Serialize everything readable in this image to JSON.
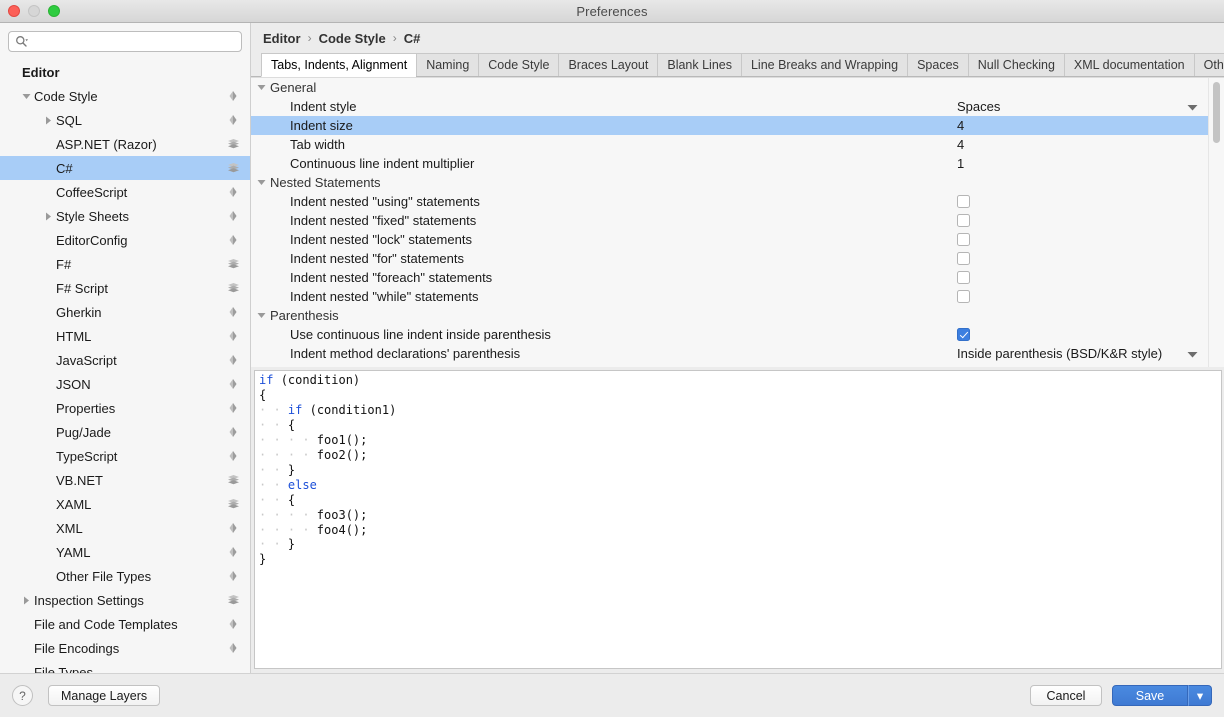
{
  "window": {
    "title": "Preferences",
    "traffic_lights": [
      "close",
      "minimize",
      "zoom"
    ]
  },
  "sidebar": {
    "search": {
      "value": "",
      "placeholder": ""
    },
    "items": [
      {
        "label": "Editor",
        "depth": 0,
        "twisty": "none",
        "icon": "none",
        "bold": true,
        "selected": false
      },
      {
        "label": "Code Style",
        "depth": 1,
        "twisty": "expanded",
        "icon": "diamond",
        "bold": false,
        "selected": false
      },
      {
        "label": "SQL",
        "depth": 2,
        "twisty": "collapsed",
        "icon": "diamond",
        "bold": false,
        "selected": false
      },
      {
        "label": "ASP.NET (Razor)",
        "depth": 2,
        "twisty": "none",
        "icon": "layers",
        "bold": false,
        "selected": false
      },
      {
        "label": "C#",
        "depth": 2,
        "twisty": "none",
        "icon": "layers",
        "bold": false,
        "selected": true
      },
      {
        "label": "CoffeeScript",
        "depth": 2,
        "twisty": "none",
        "icon": "diamond",
        "bold": false,
        "selected": false
      },
      {
        "label": "Style Sheets",
        "depth": 2,
        "twisty": "collapsed",
        "icon": "diamond",
        "bold": false,
        "selected": false
      },
      {
        "label": "EditorConfig",
        "depth": 2,
        "twisty": "none",
        "icon": "diamond",
        "bold": false,
        "selected": false
      },
      {
        "label": "F#",
        "depth": 2,
        "twisty": "none",
        "icon": "layers",
        "bold": false,
        "selected": false
      },
      {
        "label": "F# Script",
        "depth": 2,
        "twisty": "none",
        "icon": "layers",
        "bold": false,
        "selected": false
      },
      {
        "label": "Gherkin",
        "depth": 2,
        "twisty": "none",
        "icon": "diamond",
        "bold": false,
        "selected": false
      },
      {
        "label": "HTML",
        "depth": 2,
        "twisty": "none",
        "icon": "diamond",
        "bold": false,
        "selected": false
      },
      {
        "label": "JavaScript",
        "depth": 2,
        "twisty": "none",
        "icon": "diamond",
        "bold": false,
        "selected": false
      },
      {
        "label": "JSON",
        "depth": 2,
        "twisty": "none",
        "icon": "diamond",
        "bold": false,
        "selected": false
      },
      {
        "label": "Properties",
        "depth": 2,
        "twisty": "none",
        "icon": "diamond",
        "bold": false,
        "selected": false
      },
      {
        "label": "Pug/Jade",
        "depth": 2,
        "twisty": "none",
        "icon": "diamond",
        "bold": false,
        "selected": false
      },
      {
        "label": "TypeScript",
        "depth": 2,
        "twisty": "none",
        "icon": "diamond",
        "bold": false,
        "selected": false
      },
      {
        "label": "VB.NET",
        "depth": 2,
        "twisty": "none",
        "icon": "layers",
        "bold": false,
        "selected": false
      },
      {
        "label": "XAML",
        "depth": 2,
        "twisty": "none",
        "icon": "layers",
        "bold": false,
        "selected": false
      },
      {
        "label": "XML",
        "depth": 2,
        "twisty": "none",
        "icon": "diamond",
        "bold": false,
        "selected": false
      },
      {
        "label": "YAML",
        "depth": 2,
        "twisty": "none",
        "icon": "diamond",
        "bold": false,
        "selected": false
      },
      {
        "label": "Other File Types",
        "depth": 2,
        "twisty": "none",
        "icon": "diamond",
        "bold": false,
        "selected": false
      },
      {
        "label": "Inspection Settings",
        "depth": 1,
        "twisty": "collapsed",
        "icon": "layers",
        "bold": false,
        "selected": false
      },
      {
        "label": "File and Code Templates",
        "depth": 1,
        "twisty": "none",
        "icon": "diamond",
        "bold": false,
        "selected": false
      },
      {
        "label": "File Encodings",
        "depth": 1,
        "twisty": "none",
        "icon": "diamond",
        "bold": false,
        "selected": false
      },
      {
        "label": "File Types",
        "depth": 1,
        "twisty": "none",
        "icon": "none",
        "bold": false,
        "selected": false
      }
    ]
  },
  "breadcrumb": [
    "Editor",
    "Code Style",
    "C#"
  ],
  "tabs": [
    {
      "label": "Tabs, Indents, Alignment",
      "active": true
    },
    {
      "label": "Naming",
      "active": false
    },
    {
      "label": "Code Style",
      "active": false
    },
    {
      "label": "Braces Layout",
      "active": false
    },
    {
      "label": "Blank Lines",
      "active": false
    },
    {
      "label": "Line Breaks and Wrapping",
      "active": false
    },
    {
      "label": "Spaces",
      "active": false
    },
    {
      "label": "Null Checking",
      "active": false
    },
    {
      "label": "XML documentation",
      "active": false
    },
    {
      "label": "Other",
      "active": false
    }
  ],
  "options": [
    {
      "kind": "group",
      "label": "General",
      "expanded": true,
      "value_type": "none",
      "value": "",
      "selected": false
    },
    {
      "kind": "child",
      "label": "Indent style",
      "value_type": "combo",
      "value": "Spaces",
      "selected": false
    },
    {
      "kind": "child",
      "label": "Indent size",
      "value_type": "text",
      "value": "4",
      "selected": true
    },
    {
      "kind": "child",
      "label": "Tab width",
      "value_type": "text",
      "value": "4",
      "selected": false
    },
    {
      "kind": "child",
      "label": "Continuous line indent multiplier",
      "value_type": "text",
      "value": "1",
      "selected": false
    },
    {
      "kind": "group",
      "label": "Nested Statements",
      "expanded": true,
      "value_type": "none",
      "value": "",
      "selected": false
    },
    {
      "kind": "child",
      "label": "Indent nested \"using\" statements",
      "value_type": "checkbox",
      "value": false,
      "selected": false
    },
    {
      "kind": "child",
      "label": "Indent nested \"fixed\" statements",
      "value_type": "checkbox",
      "value": false,
      "selected": false
    },
    {
      "kind": "child",
      "label": "Indent nested \"lock\" statements",
      "value_type": "checkbox",
      "value": false,
      "selected": false
    },
    {
      "kind": "child",
      "label": "Indent nested \"for\" statements",
      "value_type": "checkbox",
      "value": false,
      "selected": false
    },
    {
      "kind": "child",
      "label": "Indent nested \"foreach\" statements",
      "value_type": "checkbox",
      "value": false,
      "selected": false
    },
    {
      "kind": "child",
      "label": "Indent nested \"while\" statements",
      "value_type": "checkbox",
      "value": false,
      "selected": false
    },
    {
      "kind": "group",
      "label": "Parenthesis",
      "expanded": true,
      "value_type": "none",
      "value": "",
      "selected": false
    },
    {
      "kind": "child",
      "label": "Use continuous line indent inside parenthesis",
      "value_type": "checkbox",
      "value": true,
      "selected": false
    },
    {
      "kind": "child",
      "label": "Indent method declarations' parenthesis",
      "value_type": "combo",
      "value": "Inside parenthesis (BSD/K&R style)",
      "selected": false
    }
  ],
  "preview": {
    "lines": [
      [
        {
          "t": "kw",
          "s": "if"
        },
        {
          "t": "ws",
          "s": " "
        },
        {
          "t": "p",
          "s": "(condition)"
        }
      ],
      [
        {
          "t": "p",
          "s": "{"
        }
      ],
      [
        {
          "t": "ws",
          "s": "· · "
        },
        {
          "t": "kw",
          "s": "if"
        },
        {
          "t": "ws",
          "s": " "
        },
        {
          "t": "p",
          "s": "(condition1)"
        }
      ],
      [
        {
          "t": "ws",
          "s": "· · "
        },
        {
          "t": "p",
          "s": "{"
        }
      ],
      [
        {
          "t": "ws",
          "s": "· · · · "
        },
        {
          "t": "p",
          "s": "foo1();"
        }
      ],
      [
        {
          "t": "ws",
          "s": "· · · · "
        },
        {
          "t": "p",
          "s": "foo2();"
        }
      ],
      [
        {
          "t": "ws",
          "s": "· · "
        },
        {
          "t": "p",
          "s": "}"
        }
      ],
      [
        {
          "t": "ws",
          "s": "· · "
        },
        {
          "t": "kw",
          "s": "else"
        }
      ],
      [
        {
          "t": "ws",
          "s": "· · "
        },
        {
          "t": "p",
          "s": "{"
        }
      ],
      [
        {
          "t": "ws",
          "s": "· · · · "
        },
        {
          "t": "p",
          "s": "foo3();"
        }
      ],
      [
        {
          "t": "ws",
          "s": "· · · · "
        },
        {
          "t": "p",
          "s": "foo4();"
        }
      ],
      [
        {
          "t": "ws",
          "s": "· · "
        },
        {
          "t": "p",
          "s": "}"
        }
      ],
      [
        {
          "t": "p",
          "s": "}"
        }
      ]
    ]
  },
  "footer": {
    "help_label": "?",
    "manage_layers_label": "Manage Layers",
    "cancel_label": "Cancel",
    "save_label": "Save",
    "save_caret": "▾"
  },
  "colors": {
    "selection": "#a8cdf7",
    "accent": "#3f7ad3",
    "keyword": "#1c4fd8",
    "window_bg": "#ececec",
    "panel_bg": "#f7f7f7"
  }
}
